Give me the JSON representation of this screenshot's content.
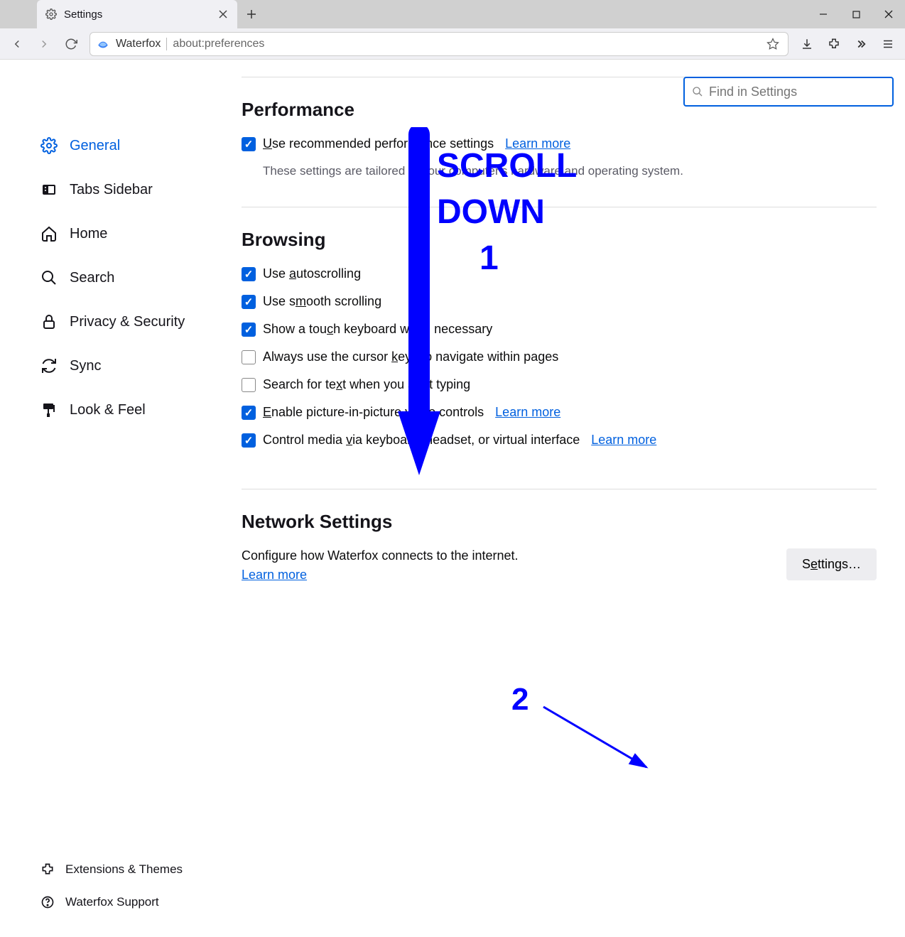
{
  "window": {
    "tab_title": "Settings",
    "url_brand": "Waterfox",
    "url_text": "about:preferences"
  },
  "search": {
    "placeholder": "Find in Settings"
  },
  "sidebar": {
    "items": [
      {
        "label": "General",
        "icon": "gear-icon",
        "active": true
      },
      {
        "label": "Tabs Sidebar",
        "icon": "sidebar-icon",
        "active": false
      },
      {
        "label": "Home",
        "icon": "home-icon",
        "active": false
      },
      {
        "label": "Search",
        "icon": "search-icon",
        "active": false
      },
      {
        "label": "Privacy & Security",
        "icon": "lock-icon",
        "active": false
      },
      {
        "label": "Sync",
        "icon": "sync-icon",
        "active": false
      },
      {
        "label": "Look & Feel",
        "icon": "paint-icon",
        "active": false
      }
    ],
    "footer": [
      {
        "label": "Extensions & Themes",
        "icon": "puzzle-icon"
      },
      {
        "label": "Waterfox Support",
        "icon": "help-icon"
      }
    ]
  },
  "performance": {
    "heading": "Performance",
    "rec_pre": "",
    "rec_u": "U",
    "rec_post": "se recommended performance settings",
    "rec_checked": true,
    "learn": "Learn more",
    "hint": "These settings are tailored to your computer's hardware and operating system."
  },
  "browsing": {
    "heading": "Browsing",
    "items": [
      {
        "pre": "Use ",
        "u": "a",
        "post": "utoscrolling",
        "checked": true,
        "learn": null
      },
      {
        "pre": "Use s",
        "u": "m",
        "post": "ooth scrolling",
        "checked": true,
        "learn": null
      },
      {
        "pre": "Show a tou",
        "u": "c",
        "post": "h keyboard when necessary",
        "checked": true,
        "learn": null
      },
      {
        "pre": "Always use the cursor ",
        "u": "k",
        "post": "eys to navigate within pages",
        "checked": false,
        "learn": null
      },
      {
        "pre": "Search for te",
        "u": "x",
        "post": "t when you start typing",
        "checked": false,
        "learn": null
      },
      {
        "pre": "",
        "u": "E",
        "post": "nable picture-in-picture video controls",
        "checked": true,
        "learn": "Learn more"
      },
      {
        "pre": "Control media ",
        "u": "v",
        "post": "ia keyboard, headset, or virtual interface",
        "checked": true,
        "learn": "Learn more"
      }
    ]
  },
  "network": {
    "heading": "Network Settings",
    "desc": "Configure how Waterfox connects to the internet.",
    "learn": "Learn more",
    "button_pre": "S",
    "button_u": "e",
    "button_post": "ttings…"
  },
  "annotation": {
    "scroll_line1": "SCROLL",
    "scroll_line2": "DOWN",
    "step1": "1",
    "step2": "2"
  }
}
